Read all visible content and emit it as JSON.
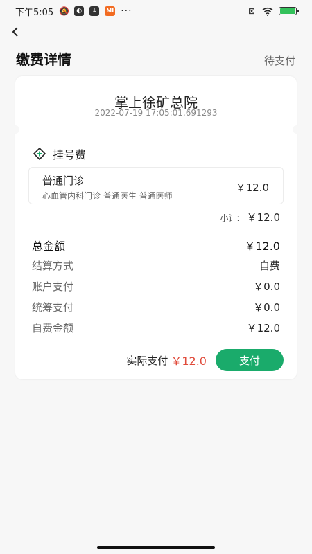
{
  "status_bar": {
    "time": "下午5:05",
    "mi_label": "MI",
    "dots": "···"
  },
  "header": {
    "title": "缴费详情",
    "status": "待支付"
  },
  "card": {
    "hospital": "掌上徐矿总院",
    "timestamp": "2022-07-19 17:05:01.691293",
    "fee_type": "挂号费",
    "item": {
      "name": "普通门诊",
      "desc": "心血管内科门诊 普通医生 普通医师",
      "price": "￥12.0"
    },
    "subtotal_label": "小计:",
    "subtotal_value": "￥12.0",
    "rows": [
      {
        "label": "总金额",
        "value": "￥12.0"
      },
      {
        "label": "结算方式",
        "value": "自费"
      },
      {
        "label": "账户支付",
        "value": "￥0.0"
      },
      {
        "label": "统筹支付",
        "value": "￥0.0"
      },
      {
        "label": "自费金额",
        "value": "￥12.0"
      }
    ],
    "actual_label": "实际支付",
    "actual_value": "￥12.0",
    "pay_button": "支付"
  },
  "colors": {
    "accent": "#1aab6b",
    "price_red": "#e04a3a",
    "battery": "#33c15a"
  }
}
